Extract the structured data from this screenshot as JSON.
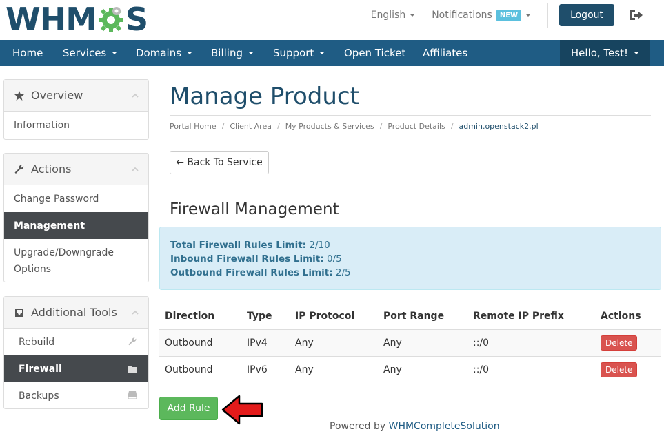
{
  "brand": {
    "logo_left": "WHM",
    "logo_right": "S",
    "primary_color": "#1f4e6b",
    "nav_color": "#1f5c84",
    "gear_color": "#5cb85c"
  },
  "top_links": {
    "language": "English",
    "notifications": "Notifications",
    "notifications_badge": "NEW",
    "logout": "Logout"
  },
  "nav": {
    "items": [
      "Home",
      "Services",
      "Domains",
      "Billing",
      "Support",
      "Open Ticket",
      "Affiliates"
    ],
    "user": "Hello, Test!"
  },
  "sidebar": {
    "overview": {
      "title": "Overview",
      "items": [
        "Information"
      ]
    },
    "actions": {
      "title": "Actions",
      "items": [
        "Change Password",
        "Management",
        "Upgrade/Downgrade",
        "Options"
      ]
    },
    "tools": {
      "title": "Additional Tools",
      "items": [
        "Rebuild",
        "Firewall",
        "Backups"
      ]
    }
  },
  "main": {
    "title": "Manage Product",
    "breadcrumb": [
      "Portal Home",
      "Client Area",
      "My Products & Services",
      "Product Details",
      "admin.openstack2.pl"
    ],
    "back_button": "← Back To Service",
    "section_title": "Firewall Management",
    "limits": [
      {
        "label": "Total Firewall Rules Limit:",
        "value": "2/10"
      },
      {
        "label": "Inbound Firewall Rules Limit:",
        "value": "0/5"
      },
      {
        "label": "Outbound Firewall Rules Limit:",
        "value": "2/5"
      }
    ],
    "table": {
      "headers": [
        "Direction",
        "Type",
        "IP Protocol",
        "Port Range",
        "Remote IP Prefix",
        "Actions"
      ],
      "rows": [
        {
          "direction": "Outbound",
          "type": "IPv4",
          "protocol": "Any",
          "port": "Any",
          "prefix": "::/0",
          "action": "Delete"
        },
        {
          "direction": "Outbound",
          "type": "IPv6",
          "protocol": "Any",
          "port": "Any",
          "prefix": "::/0",
          "action": "Delete"
        }
      ]
    },
    "add_rule": "Add Rule"
  },
  "footer": {
    "prefix": "Powered by",
    "link": "WHMCompleteSolution"
  }
}
